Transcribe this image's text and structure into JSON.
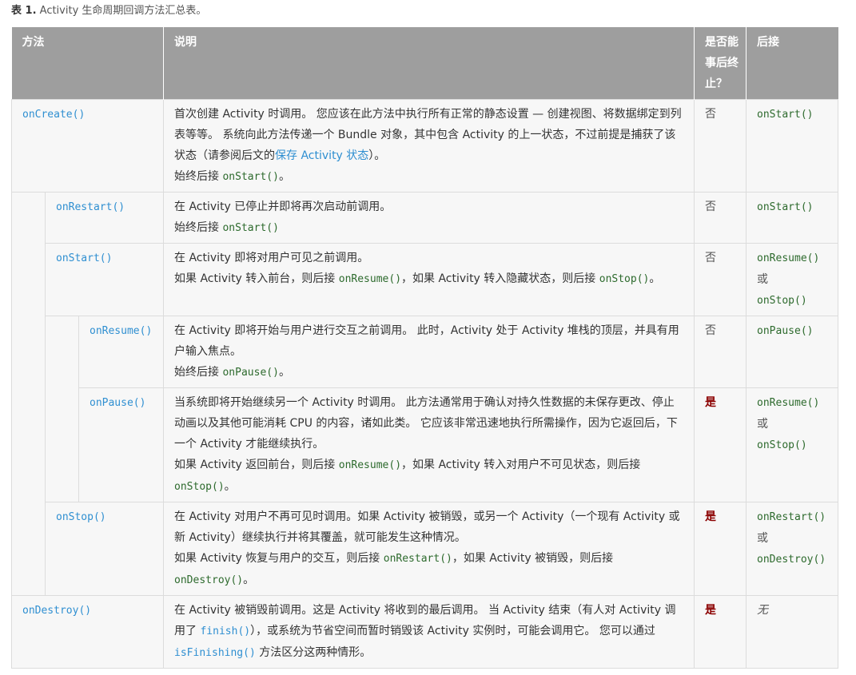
{
  "caption": {
    "label": "表 1.",
    "text": " Activity 生命周期回调方法汇总表。"
  },
  "headers": {
    "method": "方法",
    "desc": "说明",
    "killable": "是否能事后终止？",
    "next": "后接"
  },
  "rows": {
    "oncreate": {
      "method": "onCreate()",
      "desc1": "首次创建 Activity 时调用。 您应该在此方法中执行所有正常的静态设置 — 创建视图、将数据绑定到列表等等。 系统向此方法传递一个 Bundle 对象，其中包含 Activity 的上一状态，不过前提是捕获了该状态（请参阅后文的",
      "desc1_link": "保存 Activity 状态",
      "desc1_end": "）。",
      "desc2_pre": "始终后接 ",
      "desc2_code": "onStart()",
      "desc2_post": "。",
      "killable": "否",
      "next": "onStart()"
    },
    "onrestart": {
      "method": "onRestart()",
      "desc1": "在 Activity 已停止并即将再次启动前调用。",
      "desc2_pre": "始终后接 ",
      "desc2_code": "onStart()",
      "killable": "否",
      "next": "onStart()"
    },
    "onstart": {
      "method": "onStart()",
      "desc1": "在 Activity 即将对用户可见之前调用。",
      "desc2_a": "如果 Activity 转入前台，则后接 ",
      "desc2_code1": "onResume()",
      "desc2_b": "，如果 Activity 转入隐藏状态，则后接 ",
      "desc2_code2": "onStop()",
      "desc2_c": "。",
      "killable": "否",
      "next1": "onResume()",
      "or": "或",
      "next2": "onStop()"
    },
    "onresume": {
      "method": "onResume()",
      "desc1": "在 Activity 即将开始与用户进行交互之前调用。 此时，Activity 处于 Activity 堆栈的顶层，并具有用户输入焦点。",
      "desc2_pre": "始终后接 ",
      "desc2_code": "onPause()",
      "desc2_post": "。",
      "killable": "否",
      "next": "onPause()"
    },
    "onpause": {
      "method": "onPause()",
      "desc1": "当系统即将开始继续另一个 Activity 时调用。 此方法通常用于确认对持久性数据的未保存更改、停止动画以及其他可能消耗 CPU 的内容，诸如此类。 它应该非常迅速地执行所需操作，因为它返回后，下一个 Activity 才能继续执行。",
      "desc2_a": "如果 Activity 返回前台，则后接 ",
      "desc2_code1": "onResume()",
      "desc2_b": "，如果 Activity 转入对用户不可见状态，则后接 ",
      "desc2_code2": "onStop()",
      "desc2_c": "。",
      "killable": "是",
      "next1": "onResume()",
      "or": "或",
      "next2": "onStop()"
    },
    "onstop": {
      "method": "onStop()",
      "desc1": "在 Activity 对用户不再可见时调用。如果 Activity 被销毁，或另一个 Activity（一个现有 Activity 或新 Activity）继续执行并将其覆盖，就可能发生这种情况。",
      "desc2_a": "如果 Activity 恢复与用户的交互，则后接 ",
      "desc2_code1": "onRestart()",
      "desc2_b": "，如果 Activity 被销毁，则后接 ",
      "desc2_code2": "onDestroy()",
      "desc2_c": "。",
      "killable": "是",
      "next1": "onRestart()",
      "or": "或",
      "next2": "onDestroy()"
    },
    "ondestroy": {
      "method": "onDestroy()",
      "desc_a": "在 Activity 被销毁前调用。这是 Activity 将收到的最后调用。 当 Activity 结束（有人对 Activity 调用了 ",
      "desc_code1": "finish()",
      "desc_b": "），或系统为节省空间而暂时销毁该 Activity 实例时，可能会调用它。 您可以通过 ",
      "desc_code2": "isFinishing()",
      "desc_c": " 方法区分这两种情形。",
      "killable": "是",
      "next": "无"
    }
  }
}
